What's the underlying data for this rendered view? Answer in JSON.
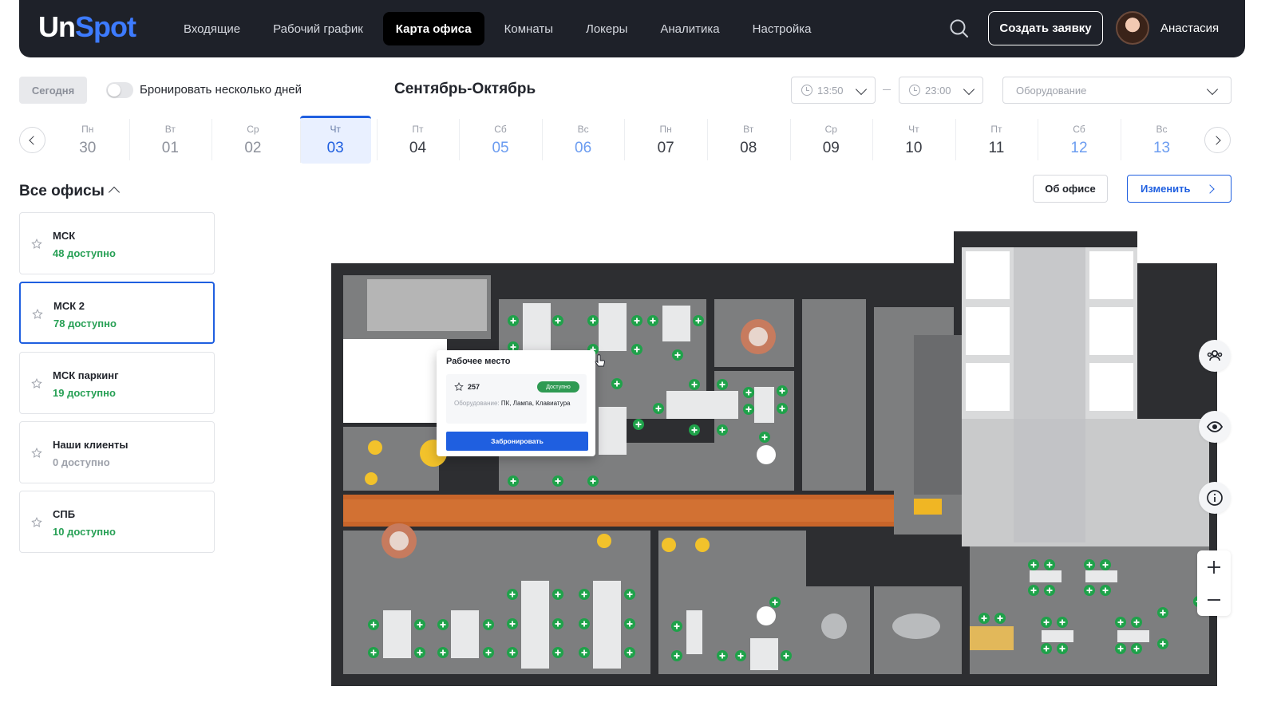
{
  "brand": {
    "logo_part1": "Un",
    "logo_part2": "Spot",
    "accent": "#1f5fe0",
    "logo_accent": "#3d7bff",
    "available_color": "#27a055"
  },
  "nav": {
    "items": [
      {
        "label": "Входящие",
        "active": false
      },
      {
        "label": "Рабочий график",
        "active": false
      },
      {
        "label": "Карта офиса",
        "active": true
      },
      {
        "label": "Комнаты",
        "active": false
      },
      {
        "label": "Локеры",
        "active": false
      },
      {
        "label": "Аналитика",
        "active": false
      },
      {
        "label": "Настройка",
        "active": false
      }
    ],
    "search_icon": "search-icon",
    "create_label": "Создать заявку",
    "user_name": "Анастасия"
  },
  "controls": {
    "today_label": "Сегодня",
    "multi_day_label": "Бронировать несколько дней",
    "multi_day_enabled": false,
    "period_title": "Сентябрь-Октябрь",
    "time_from": "13:50",
    "time_to": "23:00",
    "equipment_placeholder": "Оборудование"
  },
  "calendar": {
    "days": [
      {
        "dow": "Пн",
        "num": "30",
        "state": "past"
      },
      {
        "dow": "Вт",
        "num": "01",
        "state": "past"
      },
      {
        "dow": "Ср",
        "num": "02",
        "state": "past"
      },
      {
        "dow": "Чт",
        "num": "03",
        "state": "selected"
      },
      {
        "dow": "Пт",
        "num": "04",
        "state": "future"
      },
      {
        "dow": "Сб",
        "num": "05",
        "state": "weekend"
      },
      {
        "dow": "Вс",
        "num": "06",
        "state": "weekend"
      },
      {
        "dow": "Пн",
        "num": "07",
        "state": "future"
      },
      {
        "dow": "Вт",
        "num": "08",
        "state": "future"
      },
      {
        "dow": "Ср",
        "num": "09",
        "state": "future"
      },
      {
        "dow": "Чт",
        "num": "10",
        "state": "future"
      },
      {
        "dow": "Пт",
        "num": "11",
        "state": "future"
      },
      {
        "dow": "Сб",
        "num": "12",
        "state": "weekend"
      },
      {
        "dow": "Вс",
        "num": "13",
        "state": "weekend"
      }
    ]
  },
  "offices": {
    "title": "Все офисы",
    "items": [
      {
        "name": "МСК",
        "availability": "48 доступно",
        "selected": false,
        "available": true
      },
      {
        "name": "МСК 2",
        "availability": "78 доступно",
        "selected": true,
        "available": true
      },
      {
        "name": "МСК паркинг",
        "availability": "19 доступно",
        "selected": false,
        "available": true
      },
      {
        "name": "Наши клиенты",
        "availability": "0 доступно",
        "selected": false,
        "available": false
      },
      {
        "name": "СПБ",
        "availability": "10 доступно",
        "selected": false,
        "available": true
      }
    ]
  },
  "map_actions": {
    "about_label": "Об офисе",
    "edit_label": "Изменить"
  },
  "side_tools": [
    "people-icon",
    "eye-icon",
    "info-icon",
    "zoom-in-icon",
    "zoom-out-icon"
  ],
  "popup": {
    "title": "Рабочее место",
    "seat_number": "257",
    "status": "Доступно",
    "equipment_label": "Оборудование:",
    "equipment_value": "ПК, Лампа, Клавиатура",
    "book_label": "Забронировать"
  }
}
